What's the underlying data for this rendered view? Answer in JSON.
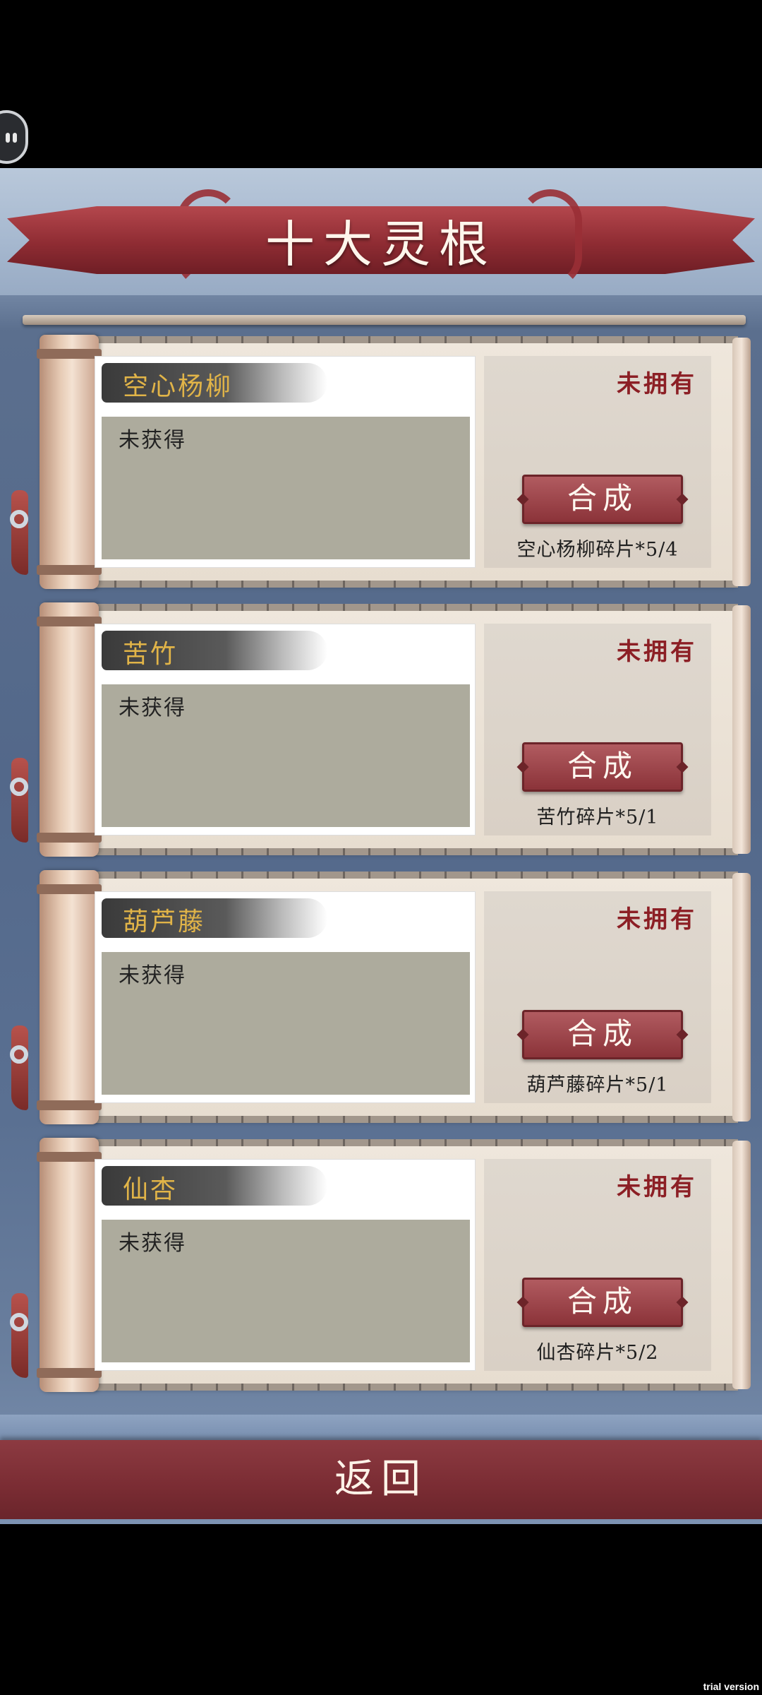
{
  "title": "十大灵根",
  "status_label": "未拥有",
  "synth_label": "合成",
  "items": [
    {
      "name": "空心杨柳",
      "description": "未获得",
      "fragments": "空心杨柳碎片*5/4"
    },
    {
      "name": "苦竹",
      "description": "未获得",
      "fragments": "苦竹碎片*5/1"
    },
    {
      "name": "葫芦藤",
      "description": "未获得",
      "fragments": "葫芦藤碎片*5/1"
    },
    {
      "name": "仙杏",
      "description": "未获得",
      "fragments": "仙杏碎片*5/2"
    }
  ],
  "back_label": "返回",
  "watermark": "trial version"
}
